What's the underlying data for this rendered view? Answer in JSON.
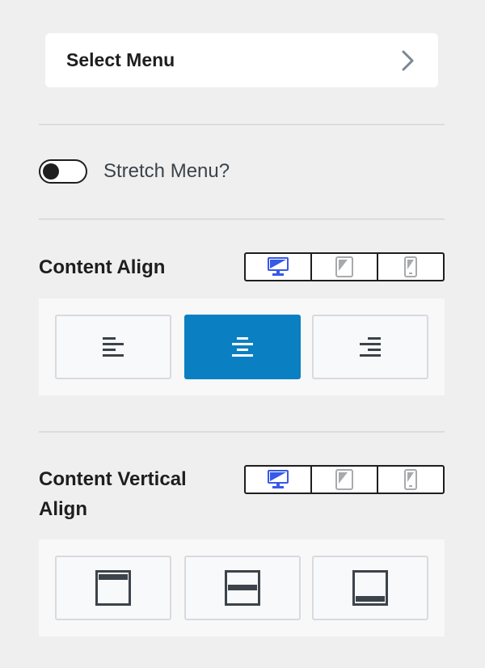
{
  "select_menu": {
    "label": "Select Menu"
  },
  "stretch_menu": {
    "label": "Stretch Menu?",
    "enabled": false
  },
  "content_align": {
    "title": "Content Align",
    "active_device": "desktop",
    "options": [
      "left",
      "center",
      "right"
    ],
    "selected": "center"
  },
  "content_vertical_align": {
    "title_line1": "Content Vertical",
    "title_line2": "Align",
    "active_device": "desktop",
    "options": [
      "top",
      "middle",
      "bottom"
    ],
    "selected": null
  },
  "colors": {
    "accent": "#0a80c2",
    "device_active": "#3858e9",
    "device_inactive": "#a7aaad",
    "icon": "#3c434a"
  },
  "icons": {
    "chevron": "chevron-right-icon",
    "desktop": "desktop-icon",
    "tablet": "tablet-icon",
    "mobile": "mobile-icon"
  }
}
